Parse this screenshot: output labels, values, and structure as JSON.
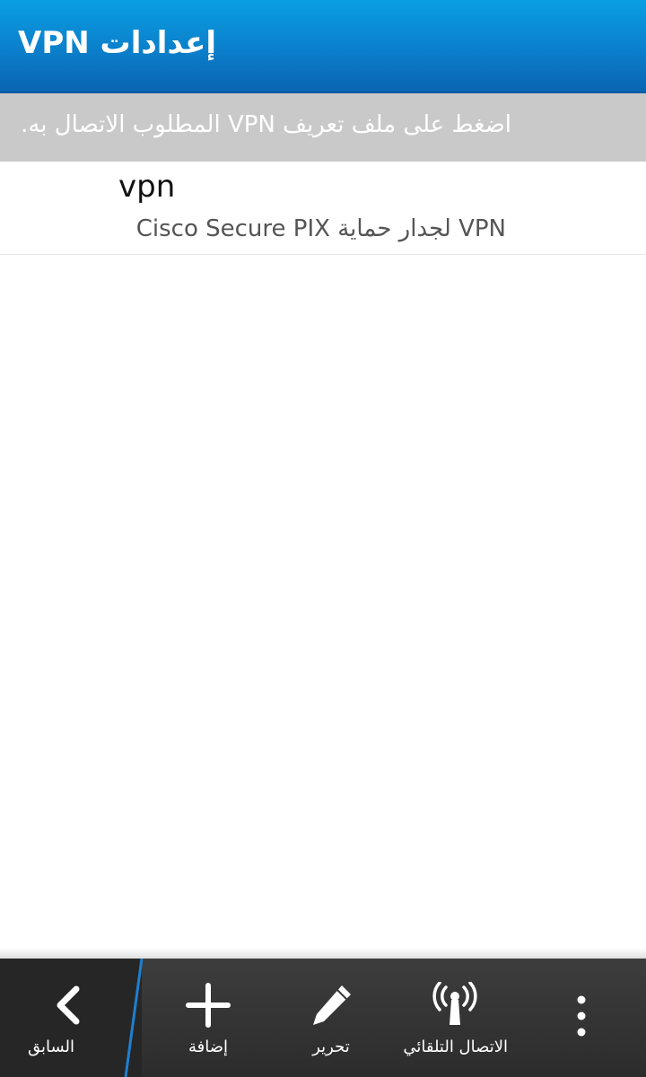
{
  "header": {
    "title": "إعدادات VPN"
  },
  "instruction": {
    "text": "اضغط على ملف تعريف VPN المطلوب الاتصال به."
  },
  "profiles": [
    {
      "name": "vpn",
      "type": "VPN لجدار حماية Cisco Secure PIX"
    }
  ],
  "actionbar": {
    "back_label": "السابق",
    "add_label": "إضافة",
    "edit_label": "تحرير",
    "connect_label": "الاتصال التلقائي"
  },
  "icons": {
    "back": "chevron-left-icon",
    "add": "plus-icon",
    "edit": "pencil-icon",
    "connect": "antenna-icon",
    "more": "overflow-dots-icon"
  },
  "colors": {
    "header_bg": "#0b7fcb",
    "instruction_bg": "#c9c9c9",
    "action_bar_bg": "#333333",
    "separator_accent": "#1e7fd0"
  }
}
